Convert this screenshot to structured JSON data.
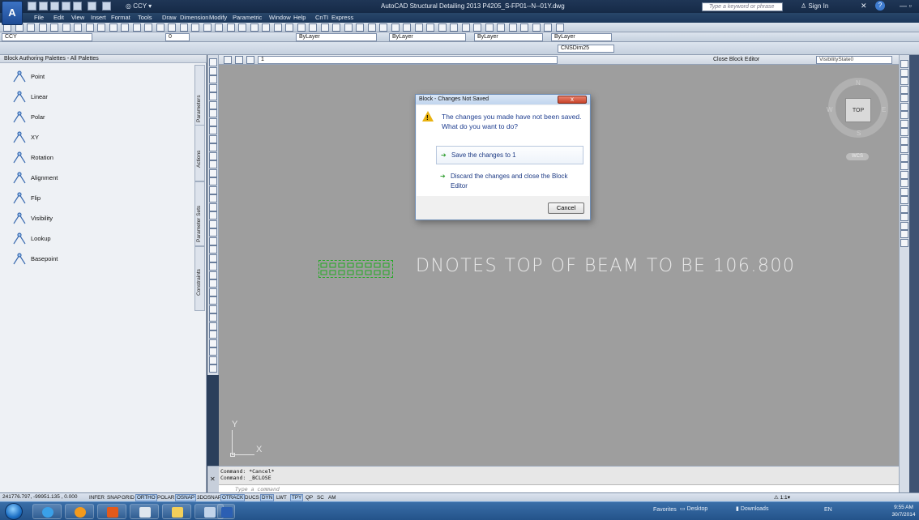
{
  "title_bar": {
    "title": "AutoCAD Structural Detailing 2013   P4205_S-FP01--N--01Y.dwg",
    "workspace": "CCY",
    "search_placeholder": "Type a keyword or phrase",
    "sign_in": "Sign In",
    "logo": "A"
  },
  "menu": [
    "File",
    "Edit",
    "View",
    "Insert",
    "Format",
    "Tools",
    "Draw",
    "Dimension",
    "Modify",
    "Parametric",
    "Window",
    "Help",
    "CnTI",
    "Express"
  ],
  "toolbar": {
    "workspace_combo": "CCY",
    "layer_combo": "0",
    "color_combo": "ByLayer",
    "linetype_combo": "ByLayer",
    "lineweight_combo": "ByLayer",
    "plotstyle_combo": "ByLayer",
    "dimstyle_combo": "CNSDim25"
  },
  "palette": {
    "title": "Block Authoring Palettes - All Palettes",
    "items": [
      {
        "label": "Point",
        "icon": "point-parameter-icon"
      },
      {
        "label": "Linear",
        "icon": "linear-parameter-icon"
      },
      {
        "label": "Polar",
        "icon": "polar-parameter-icon"
      },
      {
        "label": "XY",
        "icon": "xy-parameter-icon"
      },
      {
        "label": "Rotation",
        "icon": "rotation-parameter-icon"
      },
      {
        "label": "Alignment",
        "icon": "alignment-parameter-icon"
      },
      {
        "label": "Flip",
        "icon": "flip-parameter-icon"
      },
      {
        "label": "Visibility",
        "icon": "visibility-parameter-icon"
      },
      {
        "label": "Lookup",
        "icon": "lookup-parameter-icon"
      },
      {
        "label": "Basepoint",
        "icon": "basepoint-parameter-icon"
      }
    ],
    "tabs": [
      "Parameters",
      "Actions",
      "Parameter Sets",
      "Constraints"
    ]
  },
  "block_editor": {
    "block_name": "1",
    "close_label": "Close Block Editor",
    "visibility_state": "VisibilityState0"
  },
  "viewcube": {
    "top": "TOP",
    "n": "N",
    "s": "S",
    "e": "E",
    "w": "W",
    "wcs": "WCS"
  },
  "canvas": {
    "text": "DNOTES TOP OF BEAM TO BE 106.800",
    "ucs_x": "X",
    "ucs_y": "Y"
  },
  "dialog": {
    "title": "Block - Changes Not Saved",
    "close": "x",
    "message": "The changes you made have not been saved. What do you want to do?",
    "save_option": "Save the changes to 1",
    "discard_option": "Discard the changes and close the Block Editor",
    "cancel": "Cancel"
  },
  "command_line": {
    "line1": "Command: *Cancel*",
    "line2": "Command: _BCLOSE",
    "placeholder": "Type a command"
  },
  "status_bar": {
    "coordinates": "241776.797, -99951.135 , 0.000",
    "toggles": [
      {
        "label": "INFER",
        "on": false
      },
      {
        "label": "SNAP",
        "on": false
      },
      {
        "label": "GRID",
        "on": false
      },
      {
        "label": "ORTHO",
        "on": true
      },
      {
        "label": "POLAR",
        "on": false
      },
      {
        "label": "OSNAP",
        "on": true
      },
      {
        "label": "3DOSNAP",
        "on": false
      },
      {
        "label": "OTRACK",
        "on": true
      },
      {
        "label": "DUCS",
        "on": false
      },
      {
        "label": "DYN",
        "on": true
      },
      {
        "label": "LWT",
        "on": false
      },
      {
        "label": "TPY",
        "on": true
      },
      {
        "label": "QP",
        "on": false
      },
      {
        "label": "SC",
        "on": false
      },
      {
        "label": "AM",
        "on": false
      }
    ],
    "scale": "1:1"
  },
  "taskbar": {
    "favorites": "Favorites",
    "desktop": "Desktop",
    "downloads": "Downloads",
    "lang": "EN",
    "time": "9:55 AM",
    "date": "30/7/2014"
  },
  "colors": {
    "accent": "#1e4b94",
    "canvas": "#9e9e9e",
    "dialog_link": "#1d3a84",
    "attdef": "#22aa22"
  }
}
